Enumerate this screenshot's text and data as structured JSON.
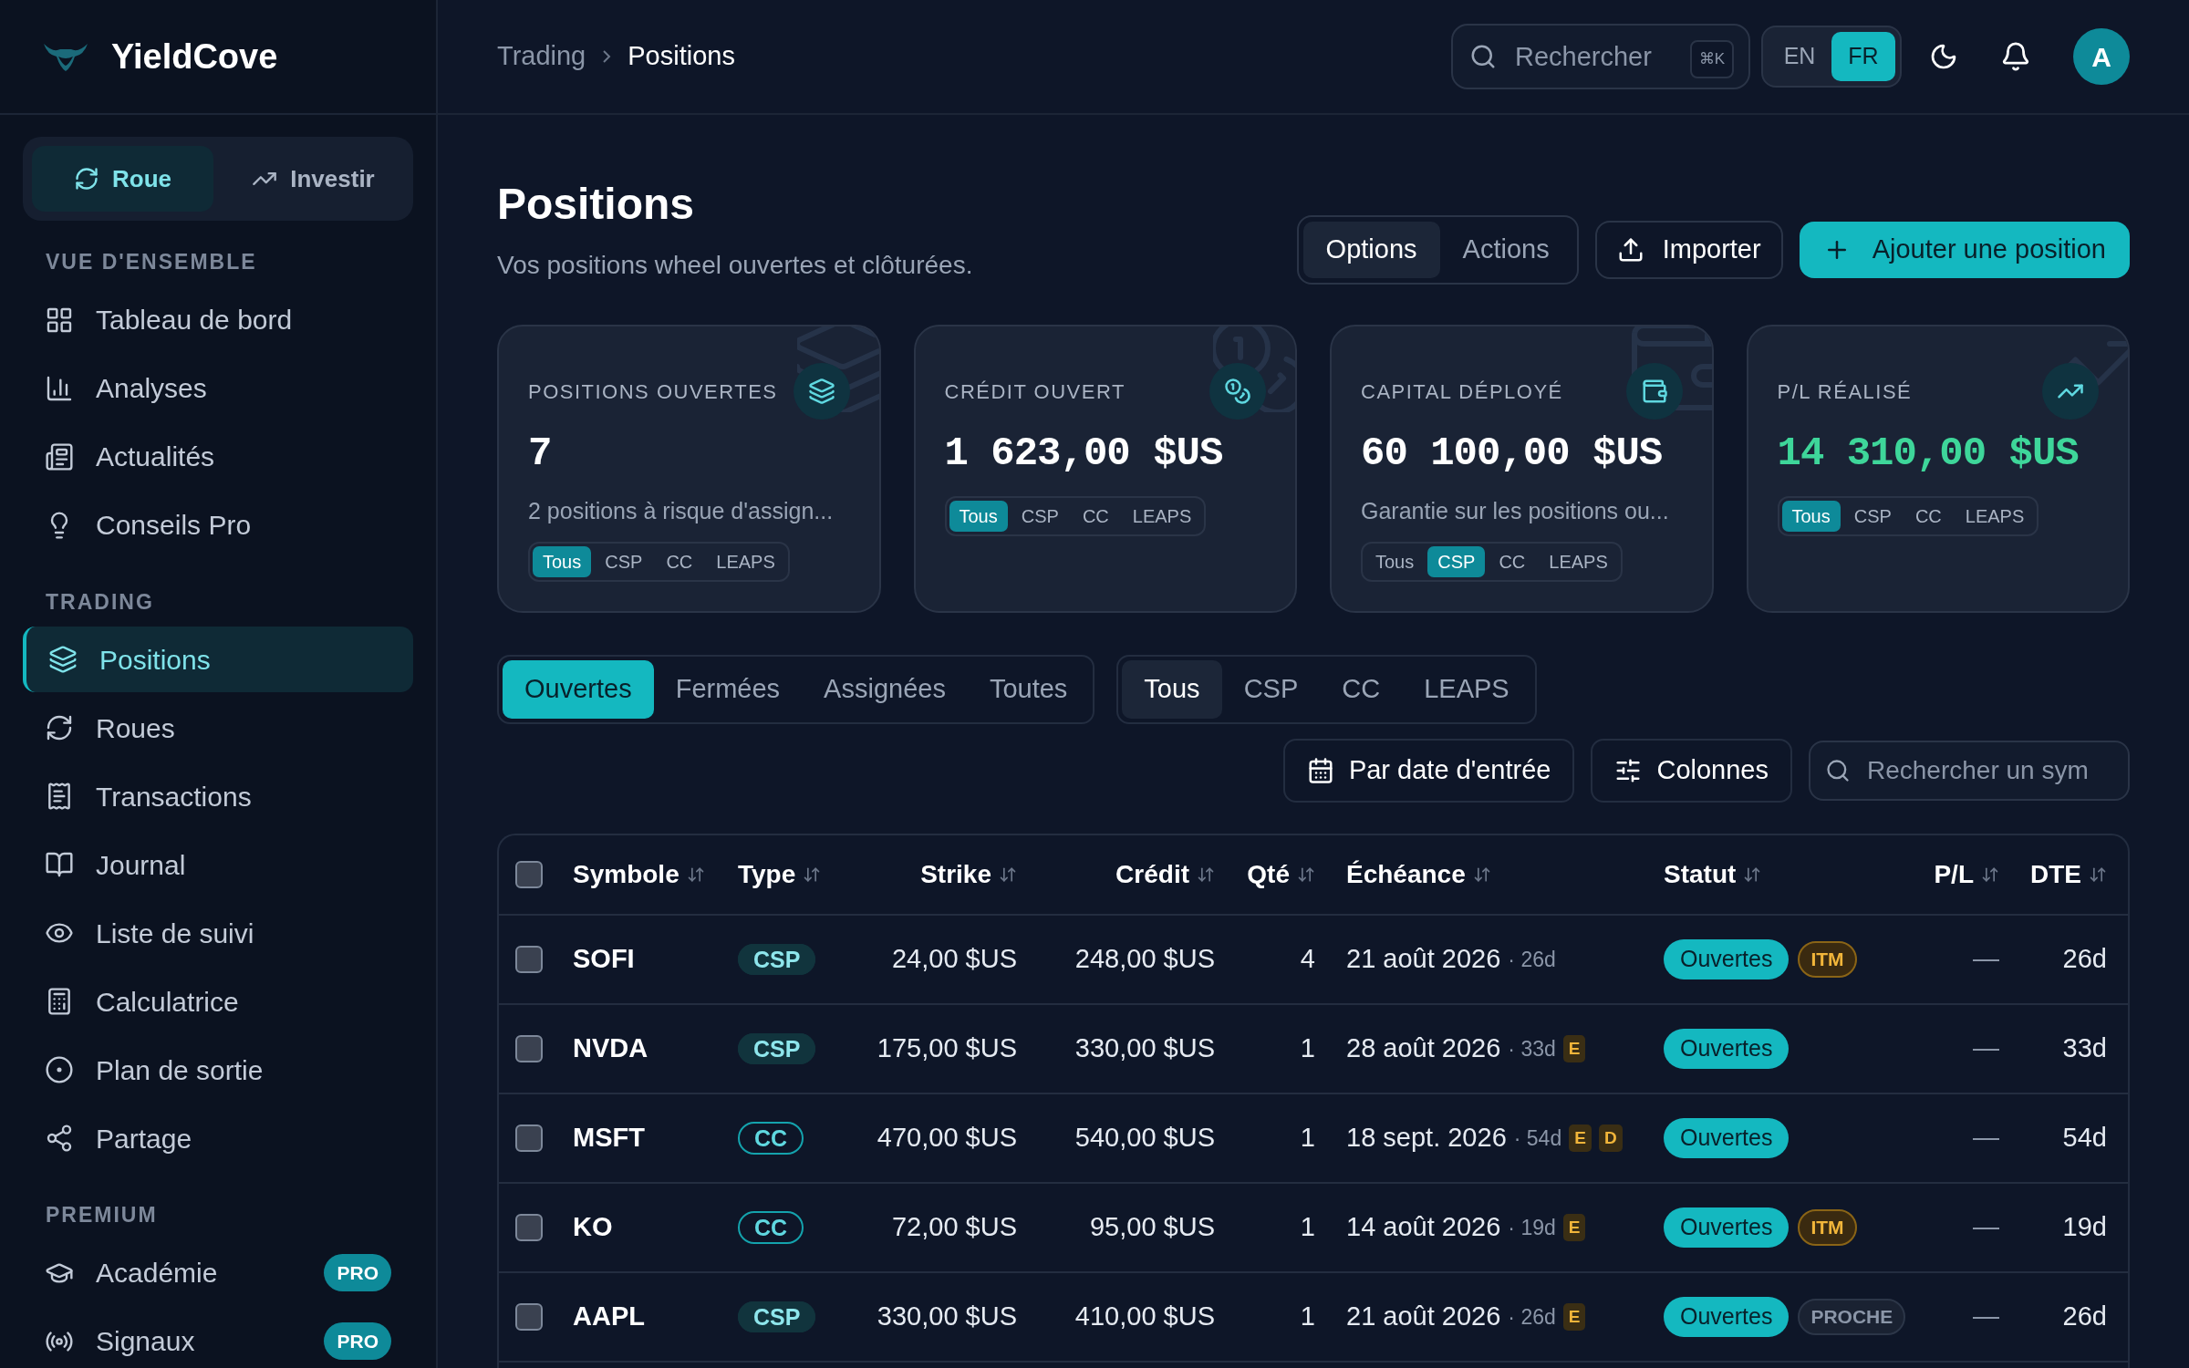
{
  "brand": "YieldCove",
  "mode_switch": [
    {
      "label": "Roue",
      "selected": true
    },
    {
      "label": "Investir",
      "selected": false
    }
  ],
  "sidebar": [
    {
      "title": "VUE D'ENSEMBLE",
      "items": [
        {
          "label": "Tableau de bord",
          "selected": false
        },
        {
          "label": "Analyses",
          "selected": false
        },
        {
          "label": "Actualités",
          "selected": false
        },
        {
          "label": "Conseils Pro",
          "selected": false
        }
      ]
    },
    {
      "title": "TRADING",
      "items": [
        {
          "label": "Positions",
          "selected": true
        },
        {
          "label": "Roues",
          "selected": false
        },
        {
          "label": "Transactions",
          "selected": false
        },
        {
          "label": "Journal",
          "selected": false
        },
        {
          "label": "Liste de suivi",
          "selected": false
        },
        {
          "label": "Calculatrice",
          "selected": false
        },
        {
          "label": "Plan de sortie",
          "selected": false
        },
        {
          "label": "Partage",
          "selected": false
        }
      ]
    },
    {
      "title": "PREMIUM",
      "items": [
        {
          "label": "Académie",
          "selected": false,
          "badge": "PRO"
        },
        {
          "label": "Signaux",
          "selected": false,
          "badge": "PRO"
        }
      ]
    }
  ],
  "breadcrumb": [
    "Trading",
    "Positions"
  ],
  "search": {
    "placeholder": "Rechercher",
    "shortcut": "⌘K"
  },
  "languages": [
    {
      "label": "EN",
      "selected": false
    },
    {
      "label": "FR",
      "selected": true
    }
  ],
  "avatar": "A",
  "page": {
    "title": "Positions",
    "subtitle": "Vos positions wheel ouvertes et clôturées."
  },
  "asset_tabs": [
    {
      "label": "Options",
      "selected": true
    },
    {
      "label": "Actions",
      "selected": false
    }
  ],
  "import_button": "Importer",
  "add_button": "Ajouter une position",
  "stat_cards": [
    {
      "title": "POSITIONS OUVERTES",
      "value": "7",
      "positive": false,
      "subtitle": "2 positions à risque d'assign...",
      "filters": [
        {
          "label": "Tous",
          "selected": true
        },
        {
          "label": "CSP",
          "selected": false
        },
        {
          "label": "CC",
          "selected": false
        },
        {
          "label": "LEAPS",
          "selected": false
        }
      ]
    },
    {
      "title": "CRÉDIT OUVERT",
      "value": "1 623,00 $US",
      "positive": false,
      "filters": [
        {
          "label": "Tous",
          "selected": true
        },
        {
          "label": "CSP",
          "selected": false
        },
        {
          "label": "CC",
          "selected": false
        },
        {
          "label": "LEAPS",
          "selected": false
        }
      ]
    },
    {
      "title": "CAPITAL DÉPLOYÉ",
      "value": "60 100,00 $US",
      "positive": false,
      "subtitle": "Garantie sur les positions ou...",
      "filters": [
        {
          "label": "Tous",
          "selected": false
        },
        {
          "label": "CSP",
          "selected": true
        },
        {
          "label": "CC",
          "selected": false
        },
        {
          "label": "LEAPS",
          "selected": false
        }
      ]
    },
    {
      "title": "P/L RÉALISÉ",
      "value": "14 310,00 $US",
      "positive": true,
      "filters": [
        {
          "label": "Tous",
          "selected": true
        },
        {
          "label": "CSP",
          "selected": false
        },
        {
          "label": "CC",
          "selected": false
        },
        {
          "label": "LEAPS",
          "selected": false
        }
      ]
    }
  ],
  "status_tabs": [
    {
      "label": "Ouvertes",
      "selected": true
    },
    {
      "label": "Fermées",
      "selected": false
    },
    {
      "label": "Assignées",
      "selected": false
    },
    {
      "label": "Toutes",
      "selected": false
    }
  ],
  "type_tabs": [
    {
      "label": "Tous",
      "selected": true
    },
    {
      "label": "CSP",
      "selected": false
    },
    {
      "label": "CC",
      "selected": false
    },
    {
      "label": "LEAPS",
      "selected": false
    }
  ],
  "sort_button": "Par date d'entrée",
  "columns_button": "Colonnes",
  "symbol_search": {
    "placeholder": "Rechercher un sym"
  },
  "table": {
    "all_checked": false,
    "columns": [
      "Symbole",
      "Type",
      "Strike",
      "Crédit",
      "Qté",
      "Échéance",
      "Statut",
      "P/L",
      "DTE"
    ],
    "rows": [
      {
        "checked": false,
        "symbol": "SOFI",
        "type": {
          "label": "CSP",
          "kind": "filled"
        },
        "strike": "24,00 $US",
        "credit": "248,00 $US",
        "qty": "4",
        "expiry": "21 août 2026",
        "days": "· 26d",
        "flags": [],
        "status": "Ouvertes",
        "tags": [
          {
            "label": "ITM",
            "kind": "warning"
          }
        ],
        "pl": "—",
        "dte": "26d"
      },
      {
        "checked": false,
        "symbol": "NVDA",
        "type": {
          "label": "CSP",
          "kind": "filled"
        },
        "strike": "175,00 $US",
        "credit": "330,00 $US",
        "qty": "1",
        "expiry": "28 août 2026",
        "days": "· 33d",
        "flags": [
          "E"
        ],
        "status": "Ouvertes",
        "tags": [],
        "pl": "—",
        "dte": "33d"
      },
      {
        "checked": false,
        "symbol": "MSFT",
        "type": {
          "label": "CC",
          "kind": "outline"
        },
        "strike": "470,00 $US",
        "credit": "540,00 $US",
        "qty": "1",
        "expiry": "18 sept. 2026",
        "days": "· 54d",
        "flags": [
          "E",
          "D"
        ],
        "status": "Ouvertes",
        "tags": [],
        "pl": "—",
        "dte": "54d"
      },
      {
        "checked": false,
        "symbol": "KO",
        "type": {
          "label": "CC",
          "kind": "outline"
        },
        "strike": "72,00 $US",
        "credit": "95,00 $US",
        "qty": "1",
        "expiry": "14 août 2026",
        "days": "· 19d",
        "flags": [
          "E"
        ],
        "status": "Ouvertes",
        "tags": [
          {
            "label": "ITM",
            "kind": "warning"
          }
        ],
        "pl": "—",
        "dte": "19d"
      },
      {
        "checked": false,
        "symbol": "AAPL",
        "type": {
          "label": "CSP",
          "kind": "filled"
        },
        "strike": "330,00 $US",
        "credit": "410,00 $US",
        "qty": "1",
        "expiry": "21 août 2026",
        "days": "· 26d",
        "flags": [
          "E"
        ],
        "status": "Ouvertes",
        "tags": [
          {
            "label": "PROCHE",
            "kind": "muted"
          }
        ],
        "pl": "—",
        "dte": "26d"
      }
    ]
  }
}
